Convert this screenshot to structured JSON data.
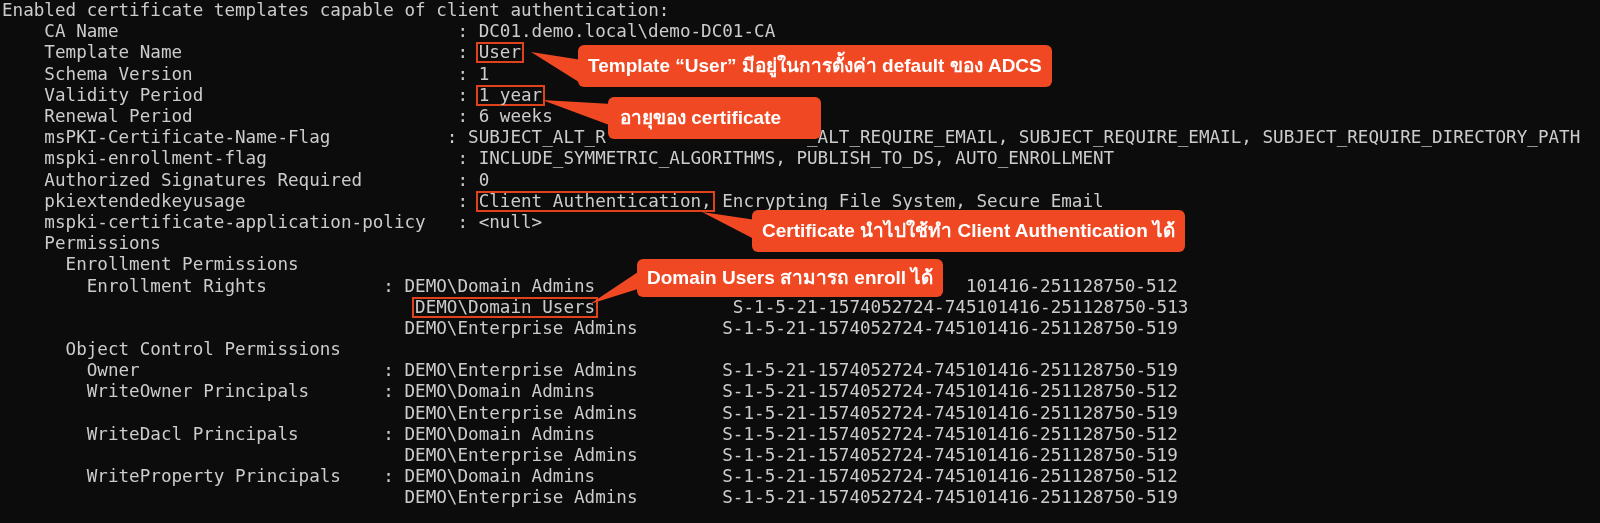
{
  "terminal": {
    "lines": [
      {
        "segments": [
          {
            "text": "Enabled certificate templates capable of client authentication:",
            "kind": "text",
            "boxed": false
          }
        ]
      },
      {
        "segments": [
          {
            "text": "    CA Name                                : DC01.demo.local\\demo-DC01-CA",
            "kind": "text",
            "boxed": false
          }
        ]
      },
      {
        "segments": [
          {
            "text": "    Template Name                          : ",
            "kind": "text",
            "boxed": false
          },
          {
            "text": "User",
            "kind": "text",
            "boxed": true
          }
        ]
      },
      {
        "segments": [
          {
            "text": "    Schema Version                         : 1",
            "kind": "text",
            "boxed": false
          }
        ]
      },
      {
        "segments": [
          {
            "text": "    Validity Period                        : ",
            "kind": "text",
            "boxed": false
          },
          {
            "text": "1 year",
            "kind": "text",
            "boxed": true
          }
        ]
      },
      {
        "segments": [
          {
            "text": "    Renewal Period                         : 6 weeks",
            "kind": "text",
            "boxed": false
          }
        ]
      },
      {
        "segments": [
          {
            "text": "    msPKI-Certificate-Name-Flag           : SUBJECT_ALT_R",
            "kind": "text",
            "boxed": false
          },
          {
            "text": "_ALT_REQUIRE_EMAIL, SUBJECT_REQUIRE_EMAIL, SUBJECT_REQUIRE_DIRECTORY_PATH",
            "kind": "after_callout",
            "boxed": false
          }
        ]
      },
      {
        "segments": [
          {
            "text": "    mspki-enrollment-flag                  : INCLUDE_SYMMETRIC_ALGORITHMS, PUBLISH_TO_DS, AUTO_ENROLLMENT",
            "kind": "text",
            "boxed": false
          }
        ]
      },
      {
        "segments": [
          {
            "text": "    Authorized Signatures Required         : 0",
            "kind": "text",
            "boxed": false
          }
        ]
      },
      {
        "segments": [
          {
            "text": "    pkiextendedkeyusage                    : ",
            "kind": "text",
            "boxed": false
          },
          {
            "text": "Client Authentication,",
            "kind": "text",
            "boxed": true
          },
          {
            "text": " Encrypting File System, Secure Email",
            "kind": "text",
            "boxed": false
          }
        ]
      },
      {
        "segments": [
          {
            "text": "    mspki-certificate-application-policy   : <null>",
            "kind": "text",
            "boxed": false
          }
        ]
      },
      {
        "segments": [
          {
            "text": "    Permissions",
            "kind": "text",
            "boxed": false
          }
        ]
      },
      {
        "segments": [
          {
            "text": "      Enrollment Permissions",
            "kind": "text",
            "boxed": false
          }
        ]
      },
      {
        "segments": [
          {
            "text": "        Enrollment Rights           : DEMO\\Domain Admins",
            "kind": "text",
            "boxed": false
          },
          {
            "text": "101416-251128750-512",
            "kind": "after_callout",
            "boxed": false
          }
        ]
      },
      {
        "segments": [
          {
            "text": "                                       DEMO\\Domain Users",
            "kind": "text",
            "boxed": true
          },
          {
            "text": "             S-1-5-21-1574052724-745101416-251128750-513",
            "kind": "text",
            "boxed": false
          }
        ]
      },
      {
        "segments": [
          {
            "text": "                                      DEMO\\Enterprise Admins        S-1-5-21-1574052724-745101416-251128750-519",
            "kind": "text",
            "boxed": false
          }
        ]
      },
      {
        "segments": [
          {
            "text": "      Object Control Permissions",
            "kind": "text",
            "boxed": false
          }
        ]
      },
      {
        "segments": [
          {
            "text": "        Owner                       : DEMO\\Enterprise Admins        S-1-5-21-1574052724-745101416-251128750-519",
            "kind": "text",
            "boxed": false
          }
        ]
      },
      {
        "segments": [
          {
            "text": "        WriteOwner Principals       : DEMO\\Domain Admins            S-1-5-21-1574052724-745101416-251128750-512",
            "kind": "text",
            "boxed": false
          }
        ]
      },
      {
        "segments": [
          {
            "text": "                                      DEMO\\Enterprise Admins        S-1-5-21-1574052724-745101416-251128750-519",
            "kind": "text",
            "boxed": false
          }
        ]
      },
      {
        "segments": [
          {
            "text": "        WriteDacl Principals        : DEMO\\Domain Admins            S-1-5-21-1574052724-745101416-251128750-512",
            "kind": "text",
            "boxed": false
          }
        ]
      },
      {
        "segments": [
          {
            "text": "                                      DEMO\\Enterprise Admins        S-1-5-21-1574052724-745101416-251128750-519",
            "kind": "text",
            "boxed": false
          }
        ]
      },
      {
        "segments": [
          {
            "text": "        WriteProperty Principals    : DEMO\\Domain Admins            S-1-5-21-1574052724-745101416-251128750-512",
            "kind": "text",
            "boxed": false
          }
        ]
      },
      {
        "segments": [
          {
            "text": "                                      DEMO\\Enterprise Admins        S-1-5-21-1574052724-745101416-251128750-519",
            "kind": "text",
            "boxed": false
          }
        ]
      }
    ]
  },
  "callouts": [
    {
      "text": "Template “User” มีอยู่ในการตั้งค่า default ของ ADCS"
    },
    {
      "text": "อายุของ certificate"
    },
    {
      "text": "Certificate นำไปใช้ทำ Client Authentication ได้"
    },
    {
      "text": "Domain Users สามารถ enroll ได้"
    }
  ]
}
